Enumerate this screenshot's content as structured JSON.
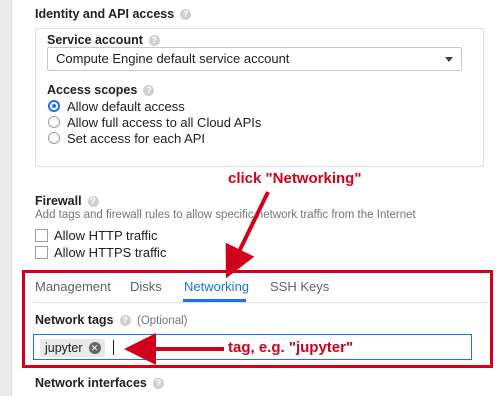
{
  "identity": {
    "title": "Identity and API access",
    "service_account": {
      "label": "Service account",
      "selected": "Compute Engine default service account"
    },
    "access_scopes": {
      "label": "Access scopes",
      "options": [
        {
          "label": "Allow default access",
          "selected": true
        },
        {
          "label": "Allow full access to all Cloud APIs",
          "selected": false
        },
        {
          "label": "Set access for each API",
          "selected": false
        }
      ]
    }
  },
  "firewall": {
    "title": "Firewall",
    "description": "Add tags and firewall rules to allow specific network traffic from the Internet",
    "options": [
      {
        "label": "Allow HTTP traffic",
        "checked": false
      },
      {
        "label": "Allow HTTPS traffic",
        "checked": false
      }
    ]
  },
  "tabs": [
    {
      "label": "Management",
      "active": false
    },
    {
      "label": "Disks",
      "active": false
    },
    {
      "label": "Networking",
      "active": true
    },
    {
      "label": "SSH Keys",
      "active": false
    }
  ],
  "network_tags": {
    "label": "Network tags",
    "optional": "(Optional)",
    "chips": [
      "jupyter"
    ]
  },
  "network_interfaces": {
    "label": "Network interfaces"
  },
  "annotations": {
    "click_networking": "click \"Networking\"",
    "tag_hint": "tag, e.g. \"jupyter\""
  },
  "colors": {
    "accent": "#1a73e8",
    "annotation": "#d0021b"
  },
  "icons": {
    "help": "help-circle-icon",
    "dropdown": "chevron-down-icon",
    "remove_chip": "close-circle-icon"
  }
}
